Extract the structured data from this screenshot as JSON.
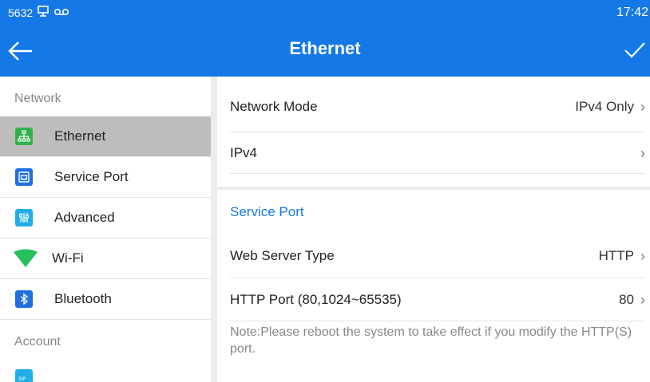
{
  "status_bar": {
    "id_text": "5632",
    "time": "17:42",
    "icons": [
      "screen-icon",
      "voicemail-icon"
    ]
  },
  "title_bar": {
    "title": "Ethernet",
    "back_icon": "arrow-left-icon",
    "confirm_icon": "check-icon"
  },
  "sidebar": {
    "section_network": "Network",
    "items": [
      {
        "label": "Ethernet",
        "icon": "ethernet-icon",
        "color": "#2fb24a",
        "active": true
      },
      {
        "label": "Service Port",
        "icon": "service-port-icon",
        "color": "#1f6fe0"
      },
      {
        "label": "Advanced",
        "icon": "advanced-icon",
        "color": "#1faee6"
      },
      {
        "label": "Wi-Fi",
        "icon": "wifi-icon",
        "color": "#22c15b"
      },
      {
        "label": "Bluetooth",
        "icon": "bluetooth-icon",
        "color": "#1f6fe0"
      }
    ],
    "section_account": "Account",
    "partial_item": {
      "icon": "sip-icon",
      "color": "#1faee6"
    }
  },
  "main": {
    "network_mode": {
      "label": "Network Mode",
      "value": "IPv4 Only"
    },
    "ipv4": {
      "label": "IPv4",
      "value": ""
    },
    "service_port": {
      "title": "Service Port",
      "web_server_type": {
        "label": "Web Server Type",
        "value": "HTTP"
      },
      "http_port": {
        "label": "HTTP Port (80,1024~65535)",
        "value": "80"
      },
      "note": "Note:Please reboot the system to take effect if you modify the HTTP(S) port."
    }
  },
  "colors": {
    "accent": "#1478e6",
    "active_row": "#bdbdbd"
  }
}
